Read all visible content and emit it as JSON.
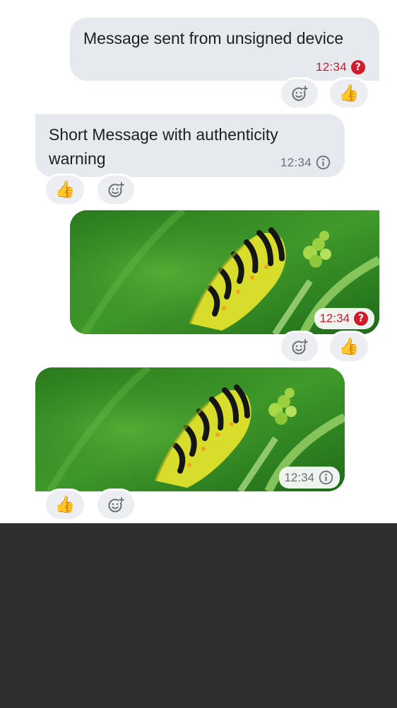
{
  "messages": [
    {
      "text": "Message sent from unsigned device",
      "time": "12:34",
      "status_icon": "question-icon",
      "status_color": "#d21a2d",
      "reactions": [
        "add-reaction-icon",
        "👍"
      ]
    },
    {
      "text": "Short Message with authenticity warning",
      "time": "12:34",
      "status_icon": "info-icon",
      "status_color": "#6b7078",
      "reactions": [
        "👍",
        "add-reaction-icon"
      ]
    },
    {
      "time": "12:34",
      "status_icon": "question-icon",
      "status_color": "#d21a2d",
      "reactions": [
        "add-reaction-icon",
        "👍"
      ]
    },
    {
      "time": "12:34",
      "status_icon": "info-icon",
      "status_color": "#6b7078",
      "reactions": [
        "👍",
        "add-reaction-icon"
      ]
    }
  ],
  "icons": {
    "question_glyph": "?",
    "thumbs_up": "👍"
  },
  "colors": {
    "bubble": "#e6e9ee",
    "warning": "#d21a2d",
    "muted": "#6b7078",
    "bottom_panel": "#2f2f2f"
  }
}
